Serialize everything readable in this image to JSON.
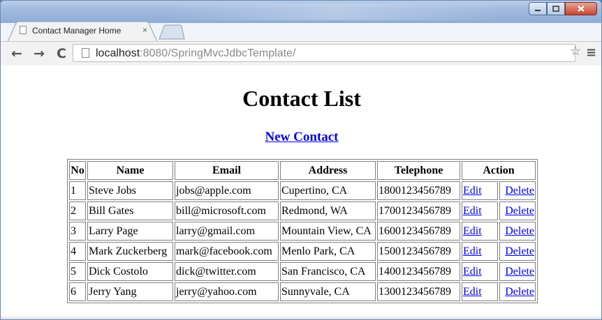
{
  "browser": {
    "tab_title": "Contact Manager Home",
    "tab_close": "×",
    "url_host": "localhost",
    "url_rest": ":8080/SpringMvcJdbcTemplate/",
    "nav": {
      "back": "←",
      "forward": "→",
      "reload": "C"
    },
    "star": "☆",
    "menu": "≡"
  },
  "page": {
    "title": "Contact List",
    "new_contact_link": "New Contact",
    "table": {
      "headers": [
        "No",
        "Name",
        "Email",
        "Address",
        "Telephone",
        "Action"
      ],
      "rows": [
        {
          "no": "1",
          "name": "Steve Jobs",
          "email": "jobs@apple.com",
          "address": "Cupertino, CA",
          "telephone": "1800123456789",
          "edit": "Edit",
          "delete": "Delete"
        },
        {
          "no": "2",
          "name": "Bill Gates",
          "email": "bill@microsoft.com",
          "address": "Redmond, WA",
          "telephone": "1700123456789",
          "edit": "Edit",
          "delete": "Delete"
        },
        {
          "no": "3",
          "name": "Larry Page",
          "email": "larry@gmail.com",
          "address": "Mountain View, CA",
          "telephone": "1600123456789",
          "edit": "Edit",
          "delete": "Delete"
        },
        {
          "no": "4",
          "name": "Mark Zuckerberg",
          "email": "mark@facebook.com",
          "address": "Menlo Park, CA",
          "telephone": "1500123456789",
          "edit": "Edit",
          "delete": "Delete"
        },
        {
          "no": "5",
          "name": "Dick Costolo",
          "email": "dick@twitter.com",
          "address": "San Francisco, CA",
          "telephone": "1400123456789",
          "edit": "Edit",
          "delete": "Delete"
        },
        {
          "no": "6",
          "name": "Jerry Yang",
          "email": "jerry@yahoo.com",
          "address": "Sunnyvale, CA",
          "telephone": "1300123456789",
          "edit": "Edit",
          "delete": "Delete"
        }
      ]
    }
  },
  "colors": {
    "link": "#0000ee",
    "titlebar": "#9fb8dc",
    "close_button": "#c9452f"
  }
}
